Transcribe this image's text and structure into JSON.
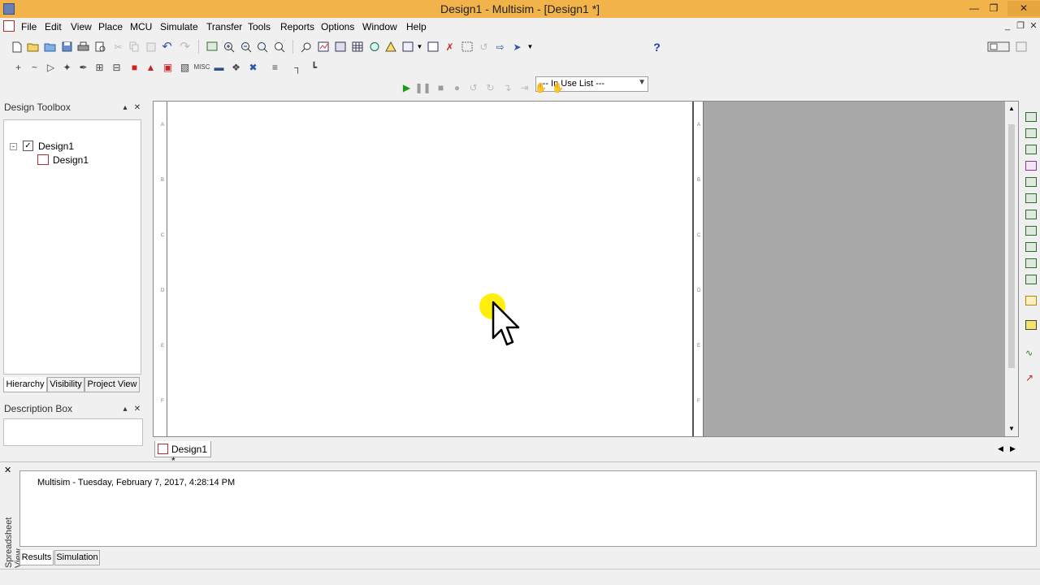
{
  "window": {
    "title": "Design1 - Multisim - [Design1 *]"
  },
  "menubar": {
    "items": [
      "File",
      "Edit",
      "View",
      "Place",
      "MCU",
      "Simulate",
      "Transfer",
      "Tools",
      "Reports",
      "Options",
      "Window",
      "Help"
    ]
  },
  "toolbar": {
    "in_use_list": "--- In Use List ---"
  },
  "design_toolbox": {
    "title": "Design Toolbox",
    "tree": {
      "root": "Design1",
      "child": "Design1"
    },
    "tabs": [
      "Hierarchy",
      "Visibility",
      "Project View"
    ]
  },
  "description_box": {
    "title": "Description Box"
  },
  "document_tab": {
    "label": "Design1 *"
  },
  "spreadsheet_view": {
    "vertical_label": "Spreadsheet View",
    "message": "Multisim  -  Tuesday, February 7, 2017, 4:28:14 PM",
    "tabs": [
      "Results",
      "Simulation"
    ]
  },
  "sheet_border": {
    "row_letters": [
      "A",
      "B",
      "C",
      "D",
      "E",
      "F"
    ]
  },
  "colors": {
    "title_bar": "#f1b34a",
    "workspace_grey": "#a8a8a8",
    "sheet_background": "#ffffff",
    "cursor_highlight": "#ffee00"
  }
}
